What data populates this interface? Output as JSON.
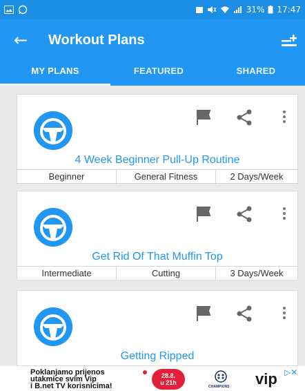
{
  "status_bar": {
    "battery": "31%",
    "time": "17:47"
  },
  "app_bar": {
    "back_icon": "arrow-left",
    "title": "Workout Plans",
    "action_icon": "add-list-icon"
  },
  "tabs": [
    {
      "label": "MY PLANS",
      "active": true
    },
    {
      "label": "FEATURED",
      "active": false
    },
    {
      "label": "SHARED",
      "active": false
    }
  ],
  "plans": [
    {
      "title": "4 Week Beginner Pull-Up Routine",
      "level": "Beginner",
      "goal": "General Fitness",
      "frequency": "2 Days/Week"
    },
    {
      "title": "Get Rid Of That Muffin Top",
      "level": "Intermediate",
      "goal": "Cutting",
      "frequency": "3 Days/Week"
    },
    {
      "title": "Getting Ripped",
      "level": "",
      "goal": "",
      "frequency": ""
    }
  ],
  "ad": {
    "text_line1": "Poklanjamo prijenos",
    "text_line2": "utakmice svim Vip",
    "text_line3": "i B.net TV korisnicima!",
    "badge_line1": "28.8.",
    "badge_line2": "u 21h",
    "champions_label": "CHAMPIONS",
    "brand": "vip"
  },
  "colors": {
    "primary": "#2196f3",
    "status": "#1d8ee6",
    "background": "#ebebeb"
  }
}
